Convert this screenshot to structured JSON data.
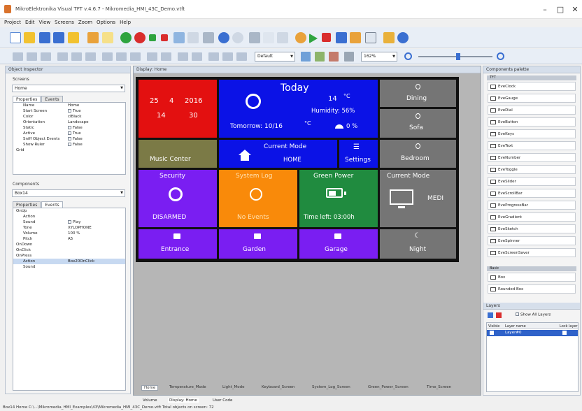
{
  "window": {
    "title": "MikroElektronika Visual TFT v.4.6.7 - Mikromedia_HMI_43C_Demo.vtft",
    "controls": [
      "–",
      "□",
      "✕"
    ]
  },
  "menu": [
    "Project",
    "Edit",
    "View",
    "Screens",
    "Zoom",
    "Options",
    "Help"
  ],
  "toolbar": {
    "style_combo": "Default",
    "zoom_combo": "162%"
  },
  "object_inspector": {
    "title": "Object Inspector",
    "screens_label": "Screens",
    "screen_value": "Home",
    "tabs": [
      "Properties",
      "Events"
    ],
    "properties": [
      {
        "key": "Name",
        "value": "Home"
      },
      {
        "key": "Start Screen",
        "value": "True",
        "check": true
      },
      {
        "key": "Color",
        "value": "clBlack"
      },
      {
        "key": "Orientation",
        "value": "Landscape"
      },
      {
        "key": "Static",
        "value": "False",
        "check": true
      },
      {
        "key": "Active",
        "value": "True",
        "check": true
      },
      {
        "key": "Sniff Object Events",
        "value": "False",
        "check": true
      },
      {
        "key": "Show Ruler",
        "value": "False",
        "check": true
      },
      {
        "key": "Grid",
        "value": "",
        "cat": true
      }
    ],
    "components_label": "Components",
    "component_value": "Box14",
    "tabs2": [
      "Properties",
      "Events"
    ],
    "events": [
      {
        "key": "OnUp",
        "value": "",
        "cat": true
      },
      {
        "key": "Action",
        "value": ""
      },
      {
        "key": "Sound",
        "value": "Play",
        "check": true
      },
      {
        "key": "Tone",
        "value": "XYLOPHONE"
      },
      {
        "key": "Volume",
        "value": "100 %"
      },
      {
        "key": "Pitch",
        "value": "A5"
      },
      {
        "key": "OnDown",
        "value": "",
        "cat": true
      },
      {
        "key": "OnClick",
        "value": "",
        "cat": true
      },
      {
        "key": "OnPress",
        "value": "",
        "cat": true
      },
      {
        "key": "Action",
        "value": "Box20OnClick",
        "sel": true
      },
      {
        "key": "Sound",
        "value": ""
      }
    ]
  },
  "designer": {
    "title": "Display: Home",
    "screen_tabs": [
      "Home",
      "Temperature_Mode",
      "Light_Mode",
      "Keyboard_Screen",
      "System_Log_Screen",
      "Green_Power_Screen",
      "Time_Screen"
    ],
    "view_tabs": [
      "Volume",
      "Display: Home",
      "User Code"
    ]
  },
  "hmi": {
    "date": {
      "day": "25",
      "month": "4",
      "year": "2016",
      "hour": "14",
      "minute": "30",
      "color": "#e31010"
    },
    "weather": {
      "title": "Today",
      "temp": "14",
      "unit": "°C",
      "humidity": "Humidity: 56%",
      "tomorrow": "Tomorrow: 10/16",
      "unit2": "°C",
      "rain": "0 %",
      "color": "#0b12e6"
    },
    "dining": {
      "label": "Dining",
      "color": "#757575"
    },
    "sofa": {
      "label": "Sofa",
      "color": "#757575"
    },
    "bedroom": {
      "label": "Bedroom",
      "color": "#757575"
    },
    "music": {
      "label": "Music Center",
      "color": "#7b7a46"
    },
    "mode": {
      "title": "Current Mode",
      "value": "HOME",
      "color": "#0b12e6"
    },
    "settings": {
      "label": "Settings",
      "color": "#0b12e6"
    },
    "security": {
      "title": "Security",
      "status": "DISARMED",
      "color": "#7a1ef2"
    },
    "syslog": {
      "title": "System Log",
      "status": "No Events",
      "color": "#f98a0a"
    },
    "green": {
      "title": "Green Power",
      "status": "Time left:  03:00h",
      "color": "#208b3f"
    },
    "current_mode2": {
      "title": "Current Mode",
      "value": "MEDI",
      "color": "#757575"
    },
    "entrance": {
      "label": "Entrance",
      "color": "#7a1ef2"
    },
    "garden": {
      "label": "Garden",
      "color": "#7a1ef2"
    },
    "garage": {
      "label": "Garage",
      "color": "#7a1ef2"
    },
    "night": {
      "label": "Night",
      "color": "#757575"
    }
  },
  "components_palette": {
    "title": "Components palette",
    "group1": "TFT",
    "items": [
      "EveClock",
      "EveGauge",
      "EveDial",
      "EveButton",
      "EveKeys",
      "EveText",
      "EveNumber",
      "EveToggle",
      "EveSlider",
      "EveScrollBar",
      "EveProgressBar",
      "EveGradient",
      "EveSketch",
      "EveSpinner",
      "EveScreenSaver"
    ],
    "group2": "Basic",
    "items2": [
      "Box",
      "Rounded Box"
    ]
  },
  "layers": {
    "title": "Layers",
    "show_all": "Show All Layers",
    "columns": [
      "Visible",
      "Layer name",
      "Lock layer"
    ],
    "rows": [
      {
        "name": "Layer#0"
      }
    ]
  },
  "statusbar": {
    "text": "Box14  Home  C:\\...\\Mikromedia_HMI_Examples\\43\\Mikromedia_HMI_43C_Demo.vtft     Total objects on screen: 72"
  }
}
